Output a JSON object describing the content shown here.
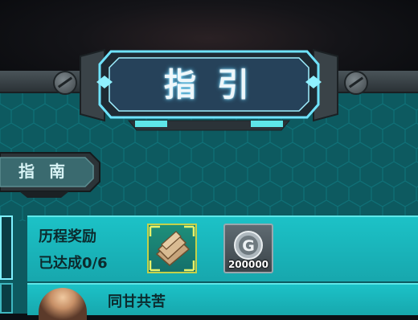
{
  "header": {
    "title": "指引"
  },
  "tabs": [
    {
      "label": "指南"
    }
  ],
  "progress_row": {
    "title": "历程奖励",
    "status": "已达成0/6",
    "rewards": [
      {
        "icon": "wood-plank-icon",
        "count": ""
      },
      {
        "icon": "g-coin-icon",
        "count": "200000"
      }
    ]
  },
  "next_row": {
    "title": "同甘共苦",
    "avatar": "character-portrait"
  },
  "colors": {
    "panel": "#0d5a60",
    "row": "#1cc2c7",
    "accent": "#5ee6e8",
    "title_glow": "#5fd3ff"
  }
}
